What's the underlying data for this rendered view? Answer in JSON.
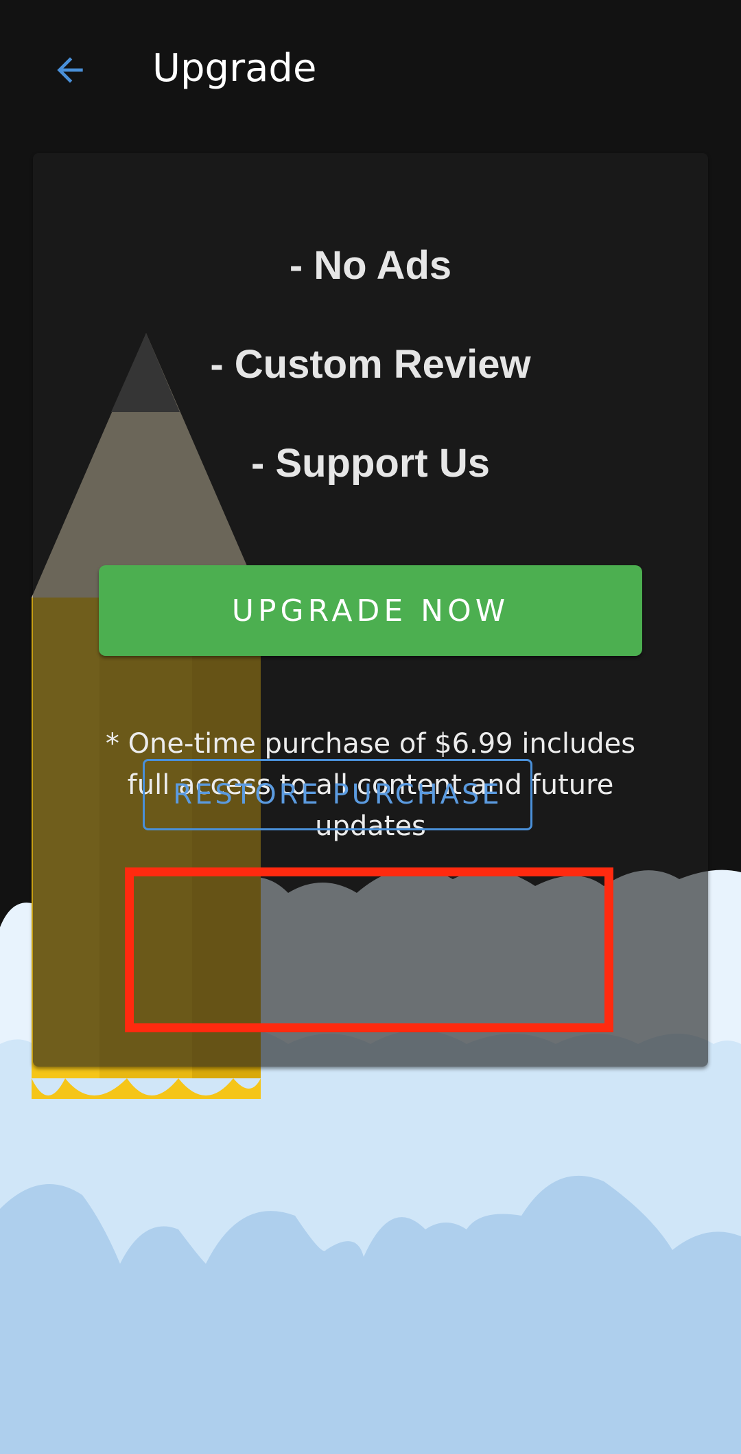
{
  "app_bar": {
    "title": "Upgrade",
    "back_icon": "arrow-left-icon"
  },
  "features": [
    {
      "label": "- No Ads"
    },
    {
      "label": "- Custom Review"
    },
    {
      "label": "- Support Us"
    }
  ],
  "upgrade_button": {
    "label": "UPGRADE NOW"
  },
  "purchase_note": "* One-time purchase of $6.99 includes full access to all content and future updates",
  "restore_button": {
    "label": "RESTORE PURCHASE"
  },
  "colors": {
    "accent_green": "#4caf50",
    "accent_blue": "#4a90d9",
    "highlight_red": "#ff2a0f",
    "background": "#121212"
  }
}
